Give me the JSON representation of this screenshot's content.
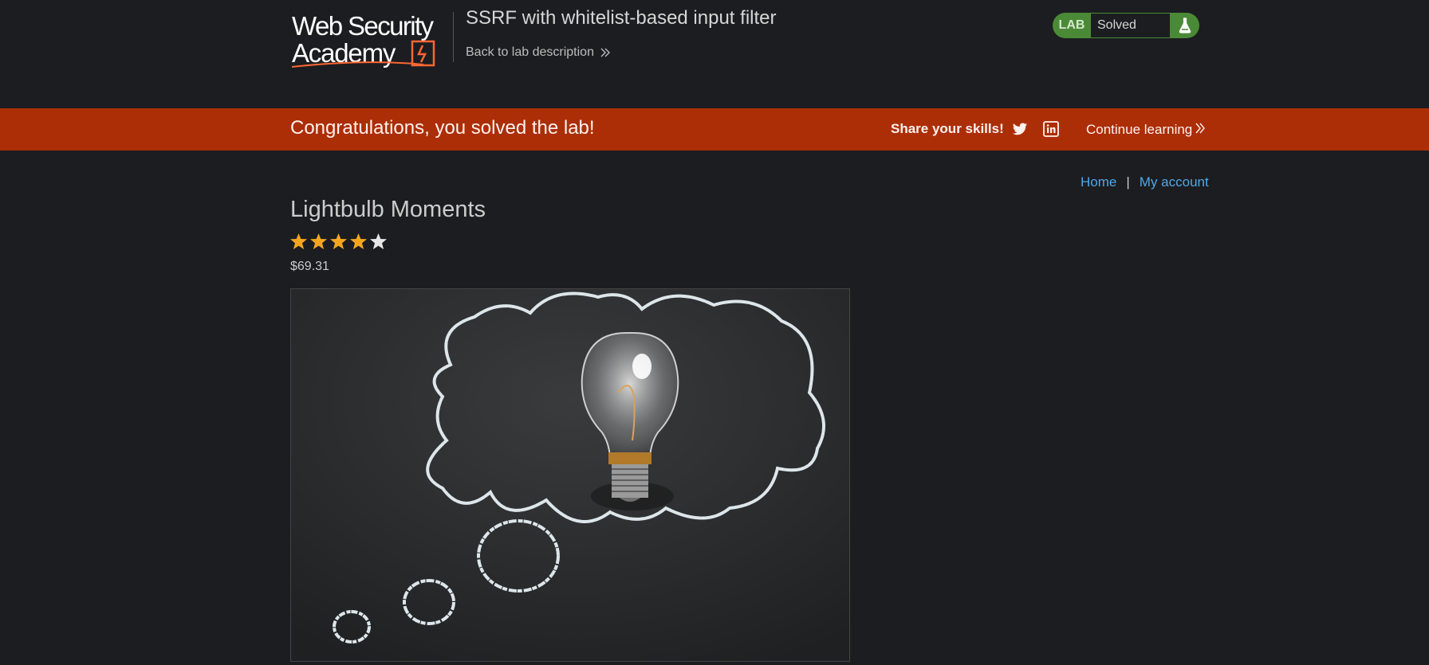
{
  "header": {
    "logo_text_line1": "Web Security",
    "logo_text_line2": "Academy",
    "lab_title": "SSRF with whitelist-based input filter",
    "back_link_label": "Back to lab description",
    "status_tag": "LAB",
    "status_text": "Solved",
    "status_icon": "flask-icon"
  },
  "banner": {
    "message": "Congratulations, you solved the lab!",
    "share_label": "Share your skills!",
    "twitter_icon": "twitter-icon",
    "linkedin_icon": "linkedin-icon",
    "continue_label": "Continue learning"
  },
  "nav": {
    "home": "Home",
    "separator": "|",
    "account": "My account"
  },
  "product": {
    "title": "Lightbulb Moments",
    "rating": 4,
    "rating_max": 5,
    "price": "$69.31",
    "image_subject": "lightbulb in chalk thought bubble"
  },
  "colors": {
    "background": "#1c1d20",
    "banner": "#ac2e07",
    "lab_green": "#4a8a36",
    "link_blue": "#4fa8e8",
    "star_filled": "#f4a621",
    "star_empty": "#e6e6e6",
    "logo_accent": "#ff6633"
  }
}
